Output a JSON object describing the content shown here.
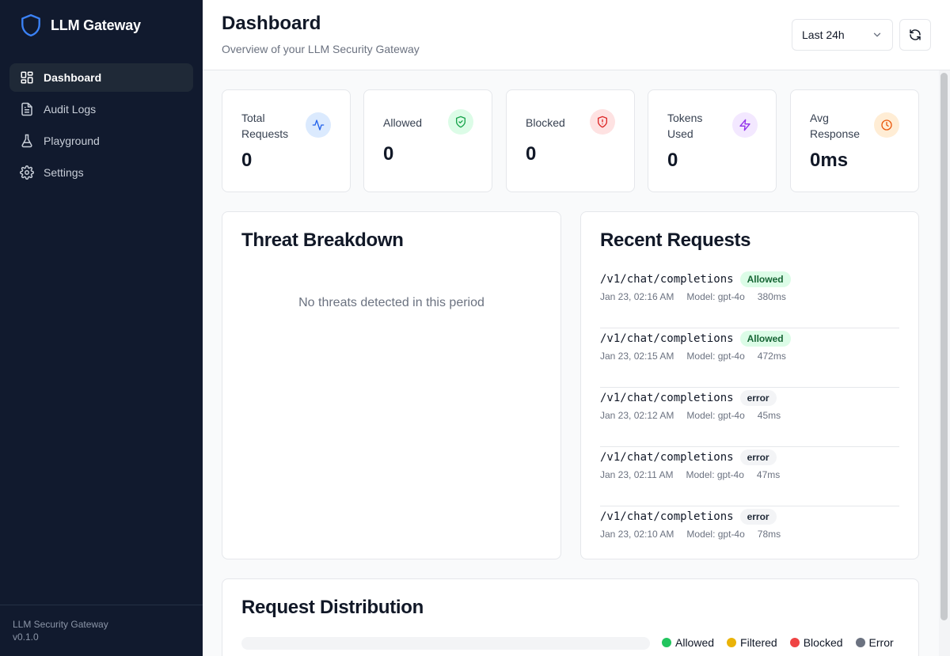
{
  "app": {
    "title": "LLM Gateway"
  },
  "sidebar": {
    "items": [
      {
        "label": "Dashboard",
        "icon": "dashboard-icon",
        "active": true
      },
      {
        "label": "Audit Logs",
        "icon": "document-icon"
      },
      {
        "label": "Playground",
        "icon": "flask-icon"
      },
      {
        "label": "Settings",
        "icon": "gear-icon"
      }
    ],
    "footer": {
      "name": "LLM Security Gateway",
      "version": "v0.1.0"
    }
  },
  "header": {
    "title": "Dashboard",
    "subtitle": "Overview of your LLM Security Gateway",
    "range": "Last 24h"
  },
  "stats": [
    {
      "label": "Total Requests",
      "value": "0",
      "icon": "activity-icon",
      "color": "#2563eb",
      "bg": "#dbeafe"
    },
    {
      "label": "Allowed",
      "value": "0",
      "icon": "shield-check-icon",
      "color": "#16a34a",
      "bg": "#dcfce7"
    },
    {
      "label": "Blocked",
      "value": "0",
      "icon": "shield-alert-icon",
      "color": "#dc2626",
      "bg": "#fee2e2"
    },
    {
      "label": "Tokens Used",
      "value": "0",
      "icon": "zap-icon",
      "color": "#9333ea",
      "bg": "#f3e8ff"
    },
    {
      "label": "Avg Response",
      "value": "0ms",
      "icon": "clock-icon",
      "color": "#ea580c",
      "bg": "#ffedd5"
    }
  ],
  "threats": {
    "title": "Threat Breakdown",
    "empty": "No threats detected in this period"
  },
  "recent": {
    "title": "Recent Requests",
    "items": [
      {
        "path": "/v1/chat/completions",
        "status": "Allowed",
        "time": "Jan 23, 02:16 AM",
        "model": "Model: gpt-4o",
        "latency": "380ms"
      },
      {
        "path": "/v1/chat/completions",
        "status": "Allowed",
        "time": "Jan 23, 02:15 AM",
        "model": "Model: gpt-4o",
        "latency": "472ms"
      },
      {
        "path": "/v1/chat/completions",
        "status": "error",
        "time": "Jan 23, 02:12 AM",
        "model": "Model: gpt-4o",
        "latency": "45ms"
      },
      {
        "path": "/v1/chat/completions",
        "status": "error",
        "time": "Jan 23, 02:11 AM",
        "model": "Model: gpt-4o",
        "latency": "47ms"
      },
      {
        "path": "/v1/chat/completions",
        "status": "error",
        "time": "Jan 23, 02:10 AM",
        "model": "Model: gpt-4o",
        "latency": "78ms"
      }
    ]
  },
  "distribution": {
    "title": "Request Distribution",
    "legend": [
      {
        "label": "Allowed",
        "color": "#22c55e"
      },
      {
        "label": "Filtered",
        "color": "#eab308"
      },
      {
        "label": "Blocked",
        "color": "#ef4444"
      },
      {
        "label": "Error",
        "color": "#6b7280"
      }
    ]
  }
}
